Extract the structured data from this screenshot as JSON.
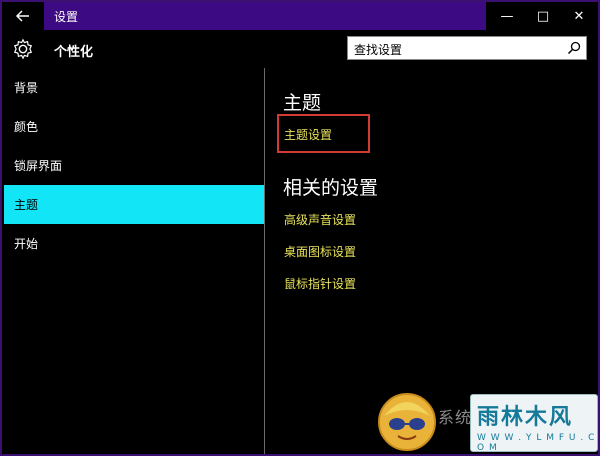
{
  "window": {
    "title": "设置",
    "controls": {
      "minimize": "—",
      "maximize": "□",
      "close": "✕"
    }
  },
  "header": {
    "page_title": "个性化",
    "search_value": "查找设置"
  },
  "sidebar": {
    "items": [
      {
        "label": "背景"
      },
      {
        "label": "颜色"
      },
      {
        "label": "锁屏界面"
      },
      {
        "label": "主题"
      },
      {
        "label": "开始"
      }
    ],
    "active_index": 3
  },
  "content": {
    "theme_heading": "主题",
    "theme_settings_link": "主题设置",
    "related_heading": "相关的设置",
    "related_links": [
      {
        "label": "高级声音设置"
      },
      {
        "label": "桌面图标设置"
      },
      {
        "label": "鼠标指针设置"
      }
    ]
  },
  "watermark": {
    "side_text": "系统",
    "title": "雨林木风",
    "url": "W W W . Y L M F U . C O M"
  },
  "colors": {
    "titlebar": "#3c0a82",
    "active_item": "#12e6f6",
    "link": "#e8e35a",
    "highlight": "#d43a34"
  },
  "icons": {
    "back": "back-arrow-icon",
    "settings": "gear-icon",
    "search": "search-icon"
  }
}
